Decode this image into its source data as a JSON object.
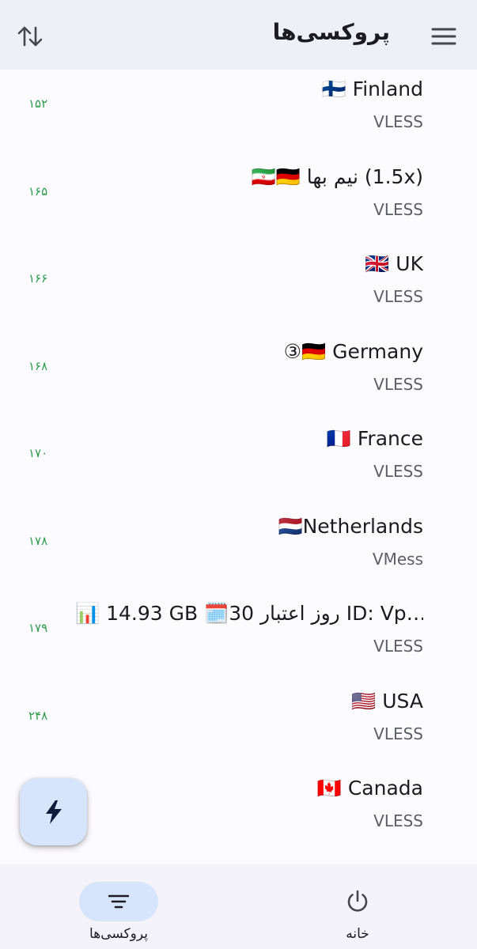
{
  "appbar": {
    "title": "پروکسی‌ها",
    "sort_icon": "swap-vertical-icon",
    "menu_icon": "hamburger-menu-icon"
  },
  "proxies": [
    {
      "name": "🇫🇮 Finland",
      "protocol": "VLESS",
      "ping": "۱۵۲"
    },
    {
      "name": "🇮🇷🇩🇪 نیم بها (1.5x)",
      "protocol": "VLESS",
      "ping": "۱۶۵"
    },
    {
      "name": "🇬🇧 UK",
      "protocol": "VLESS",
      "ping": "۱۶۶"
    },
    {
      "name": "③🇩🇪 Germany",
      "protocol": "VLESS",
      "ping": "۱۶۸"
    },
    {
      "name": "🇫🇷 France",
      "protocol": "VLESS",
      "ping": "۱۷۰"
    },
    {
      "name": "🇳🇱Netherlands",
      "protocol": "VMess",
      "ping": "۱۷۸"
    },
    {
      "name": "📊 14.93 GB 🗓️30 روز اعتبار ID: Vp…",
      "protocol": "VLESS",
      "ping": "۱۷۹"
    },
    {
      "name": "🇺🇸 USA",
      "protocol": "VLESS",
      "ping": "۲۴۸"
    },
    {
      "name": "🇨🇦 Canada",
      "protocol": "VLESS",
      "ping": ""
    }
  ],
  "fab": {
    "icon": "lightning-bolt-icon"
  },
  "bottom_nav": {
    "proxies_label": "پروکسی‌ها",
    "proxies_icon": "filter-list-icon",
    "home_label": "خانه",
    "home_icon": "power-icon"
  },
  "colors": {
    "appbar_bg": "#eff0f6",
    "ping_green": "#2e9b4a",
    "accent_container": "#d8e4fb"
  }
}
